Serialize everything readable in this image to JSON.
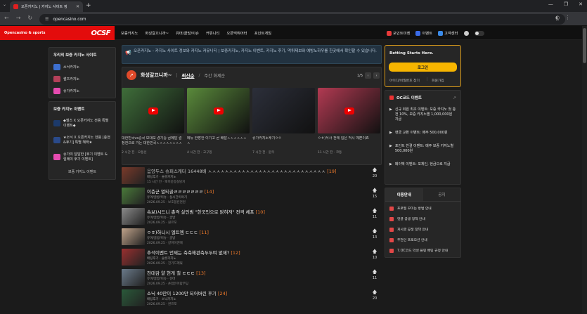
{
  "browser": {
    "tab_title": "오픈카지노 | 카지노 사이트 정",
    "tab_list_glyph": "⌄",
    "new_tab_glyph": "+",
    "url": "opencasino.com"
  },
  "site": {
    "tagline": "Opencasino & sports",
    "logo": "OCSF",
    "nav": [
      "보증카지노",
      "화성갈끄니까~",
      "유머/골방/이슈",
      "커뮤니티",
      "오픈먹튀어터",
      "포인트게임"
    ],
    "user_nav": [
      {
        "label": "포인트미켓",
        "color": "#e83a3a"
      },
      {
        "label": "이벤트",
        "color": "#3a6be8"
      },
      {
        "label": "고객센터",
        "color": "#3a8ae8"
      }
    ]
  },
  "left": {
    "panel1_title": "우리의 보증 카지노 사이트",
    "panel1_items": [
      {
        "label": "소닉카지노",
        "color": "#3d6fcf"
      },
      {
        "label": "썰즈카지노",
        "color": "#b4405a"
      },
      {
        "label": "슈가카지노",
        "color": "#e64bb0"
      }
    ],
    "panel2_title": "보증 카지노 이벤트",
    "panel2_items": [
      {
        "label": "◆썰즈 X 오픈카지노 전용 특별 이벤트◆",
        "color": "#1c3a6b"
      },
      {
        "label": "★소닉 X 오픈카지노 전용 [충전&후기] 특별 혜택★",
        "color": "#2a4a8a"
      },
      {
        "label": "슈가의 달달한 [후기 이벤트 & 릴레이 후기 이벤트]",
        "color": "#e64bb0"
      }
    ],
    "more_link": "보증 카지노 이벤트"
  },
  "notice": {
    "icon": "📢",
    "text": "오픈카지노 - 카지노 사이트 정보와 카지노 커뮤니티 | 보증카지노, 카지노 이벤트, 카지노 후기, 먹튀제보와 예방노하우를 한곳에서 확인할 수 있습니다."
  },
  "gallery": {
    "title": "화성갈끄니까~",
    "sort_active": "최신순",
    "sort_other": "주간 화제순",
    "pager": "1/5",
    "cards": [
      {
        "title": "대한민국vs중국 보대보 경기중 금메달 결정전으로 가는 대한민국ㅅㅅㅅㅅㅅㅅㅅㅅㅅㅅ",
        "meta": "2 시간 전 · 오동선",
        "bg": "#3f6e3a"
      },
      {
        "title": "메듀 한방한 이기고 곧 배달ㅅㅅㅅㅅㅅㅅㅅ",
        "meta": "4 시간 전 · 고구밍",
        "bg": "#5a8a3b"
      },
      {
        "title": "슈가카지노후기ㅇㅇ",
        "meta": "7 시간 전 · 원우",
        "bg": "#2c2f3a"
      },
      {
        "title": "ㅇㅎ)식사 전에 입은 적시 예쁜이죠",
        "meta": "11 시간 전 · 코동",
        "bg": "#b23a52"
      }
    ]
  },
  "posts": [
    {
      "title": "음양두스 슈퍼스캐터 16448배 ㅅㅅㅅㅅㅅㅅㅅㅅㅅㅅㅅㅅㅅㅅㅅㅅㅅㅅㅅㅅㅅㅅㅅㅅㅅㅅㅅㅅ",
      "count": "[19]",
      "cat": "배팅후기 · 슬롯카지노",
      "meta": "15 시간 전 · 뽀미옷등실당지",
      "votes": "20",
      "bg": "#7a3a2a",
      "dim": true
    },
    {
      "title": "이층군 멀티골ㄹㄹㄹㄹㄹㄹㄹ",
      "count": "[14]",
      "cat": "유머/골방/이슈 · 실시간이야기",
      "meta": "2026.09.25 · 보호블린천원",
      "votes": "15",
      "bg": "#4a7a3a",
      "dim": false
    },
    {
      "title": "속보)시드니 총격 살인범 \"한국인으로 밝혀져\" 전격 체포",
      "count": "[10]",
      "cat": "유머/골방/이슈 · 골방",
      "meta": "2026.09.25 · 원르포",
      "votes": "11",
      "bg": "#8a8a8a",
      "dim": false
    },
    {
      "title": "ㅇㅎ)하니시 엘트엠 ㄷㄷㄷ",
      "count": "[11]",
      "cat": "유머/골방/이슈 · 골방",
      "meta": "2026.09.25 · 갈마이앤에",
      "votes": "13",
      "bg": "#c0a38a",
      "dim": false
    },
    {
      "title": "추석이벤트 언제는 축축해관축두두며 없제?",
      "count": "[12]",
      "cat": "배팅후기 · 슬롯카지노",
      "meta": "2026.09.25 · 진기드래잌",
      "votes": "10",
      "bg": "#9a3030",
      "dim": false
    },
    {
      "title": "천대감 얄 현게 칠 ㅌㅌㅌ",
      "count": "[13]",
      "cat": "유머/골방/이슈 · 유머",
      "meta": "2026.09.25 · 손합은어답부딪",
      "votes": "11",
      "bg": "#6a7a8a",
      "dim": false
    },
    {
      "title": "소닉 40만이 1200만 되어버린 후기",
      "count": "[24]",
      "cat": "배팅후기 · 소닉카지노",
      "meta": "2026.09.25 · 원르포",
      "votes": "20",
      "bg": "#2a5a3a",
      "dim": false
    }
  ],
  "right": {
    "bet_title": "Betting Starts Here.",
    "login": "로그인",
    "find": "아이디/비밀번호 찾기",
    "register": "회원가입",
    "events_title": "OC코드 이벤트",
    "events": [
      "신규 회원 최초 이벤트: 보증 카지노 첫 충전 10%, 보증 카지노별 1,000,000원 지급",
      "현금 교환 이벤트: 매주 500,000원",
      "포인트 친결 이벤트: 매주 보증 카지노별 500,000원",
      "페이백 이벤트: 포체인, 현금으로 지급"
    ],
    "tabs": [
      "이용안내",
      "공지"
    ],
    "notices": [
      "프로필 꾸미는 방법 안내",
      "댓글 공생 정책 안내",
      "게시글 공생 정책 안내",
      "추천인 프로모션 안내",
      "7.OC코드 악성 플링 배팅 규정 안내"
    ]
  }
}
